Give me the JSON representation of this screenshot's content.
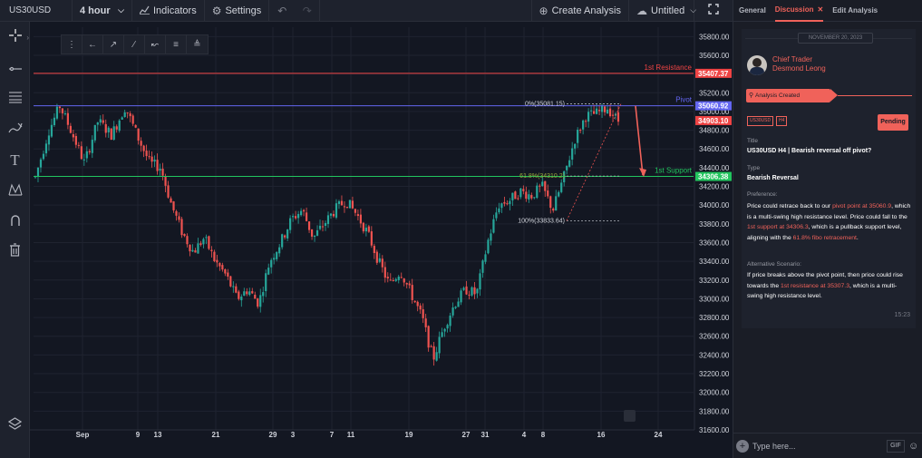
{
  "toolbar": {
    "symbol": "US30USD",
    "interval": "4 hour",
    "indicators": "Indicators",
    "settings": "Settings",
    "create_analysis": "Create Analysis",
    "layout_name": "Untitled"
  },
  "left_tools": [
    "crosshair",
    "horizontal-line",
    "fib-retracement",
    "brush",
    "text",
    "pattern",
    "magnet",
    "trash",
    "layers"
  ],
  "panel": {
    "tabs": [
      {
        "label": "General",
        "active": false
      },
      {
        "label": "Discussion",
        "active": true
      },
      {
        "label": "Edit Analysis",
        "active": false
      }
    ],
    "date": "NOVEMBER 20, 2023",
    "role": "Chief Trader",
    "author": "Desmond Leong",
    "created_tag": "Analysis Created",
    "badges": [
      "US30USD",
      "H4"
    ],
    "status": "Pending",
    "title_label": "Title",
    "title": "US30USD H4 | Bearish reversal off pivot?",
    "type_label": "Type",
    "type": "Bearish Reversal",
    "preference_label": "Preference:",
    "preference": {
      "p1": "Price could retrace back to our ",
      "h1": "pivot point at 35060.9",
      "p2": ", which is a multi-swing high resistance level. Price could fall to the ",
      "h2": "1st support at 34306.3",
      "p3": ", which is a pullback support level, aligning with the ",
      "h3": "61.8% fibo retracement",
      "p4": "."
    },
    "alternative_label": "Alternative Scenario:",
    "alternative": {
      "p1": "If price breaks above the pivot point, then price could rise towards the ",
      "h1": "1st resistance at 35307.3",
      "p2": ", which is a multi-swing high resistance level."
    },
    "time": "15:23",
    "reply_placeholder": "Type here...",
    "gif": "GIF"
  },
  "chart_data": {
    "type": "candlestick",
    "symbol": "US30USD",
    "interval": "4 hour",
    "ylim": [
      31600,
      35900
    ],
    "price_ticks": [
      31600,
      31800,
      32000,
      32200,
      32400,
      32600,
      32800,
      33000,
      33200,
      33400,
      33600,
      33800,
      34000,
      34200,
      34400,
      34600,
      34800,
      35000,
      35200,
      35400,
      35600,
      35800
    ],
    "time_ticks": [
      "Sep",
      "9",
      "13",
      "21",
      "29",
      "3",
      "7",
      "11",
      "19",
      "27",
      "31",
      "4",
      "8",
      "16",
      "24"
    ],
    "levels": [
      {
        "name": "1st Resistance",
        "price": 35407.37,
        "label": "35407.37",
        "color": "#ef4444"
      },
      {
        "name": "Pivot",
        "price": 35060.92,
        "label": "35060.92",
        "color": "#6366f1"
      },
      {
        "name": "1st Support",
        "price": 34306.38,
        "label": "34306.38",
        "color": "#22c55e"
      }
    ],
    "current_price": {
      "price": 34903.1,
      "label": "34903.10",
      "color": "#ef4444"
    },
    "fib_labels": [
      {
        "text": "0%(35081.15)",
        "price": 35081.15
      },
      {
        "text": "61.8%(34310.2)",
        "price": 34310.2
      },
      {
        "text": "100%(33833.64)",
        "price": 33833.64
      }
    ],
    "trend": [
      [
        0,
        34300
      ],
      [
        10,
        34800
      ],
      [
        18,
        35060
      ],
      [
        26,
        34800
      ],
      [
        36,
        34450
      ],
      [
        46,
        34900
      ],
      [
        56,
        34750
      ],
      [
        66,
        35050
      ],
      [
        76,
        34700
      ],
      [
        84,
        34450
      ],
      [
        92,
        34400
      ],
      [
        100,
        34000
      ],
      [
        108,
        33700
      ],
      [
        116,
        33500
      ],
      [
        124,
        33650
      ],
      [
        132,
        33400
      ],
      [
        140,
        33250
      ],
      [
        148,
        33000
      ],
      [
        156,
        33100
      ],
      [
        164,
        32950
      ],
      [
        172,
        33400
      ],
      [
        180,
        33600
      ],
      [
        188,
        33850
      ],
      [
        196,
        33950
      ],
      [
        204,
        33650
      ],
      [
        212,
        33800
      ],
      [
        220,
        33950
      ],
      [
        228,
        34050
      ],
      [
        236,
        33900
      ],
      [
        244,
        33700
      ],
      [
        252,
        33400
      ],
      [
        260,
        33150
      ],
      [
        268,
        33300
      ],
      [
        276,
        33050
      ],
      [
        284,
        32800
      ],
      [
        292,
        32350
      ],
      [
        300,
        32700
      ],
      [
        308,
        32950
      ],
      [
        316,
        33100
      ],
      [
        324,
        33050
      ],
      [
        332,
        33600
      ],
      [
        340,
        34000
      ],
      [
        348,
        34050
      ],
      [
        356,
        34150
      ],
      [
        364,
        34100
      ],
      [
        372,
        34200
      ],
      [
        380,
        33950
      ],
      [
        388,
        34300
      ],
      [
        396,
        34700
      ],
      [
        404,
        34950
      ],
      [
        412,
        34980
      ],
      [
        420,
        35040
      ],
      [
        428,
        34900
      ]
    ]
  }
}
